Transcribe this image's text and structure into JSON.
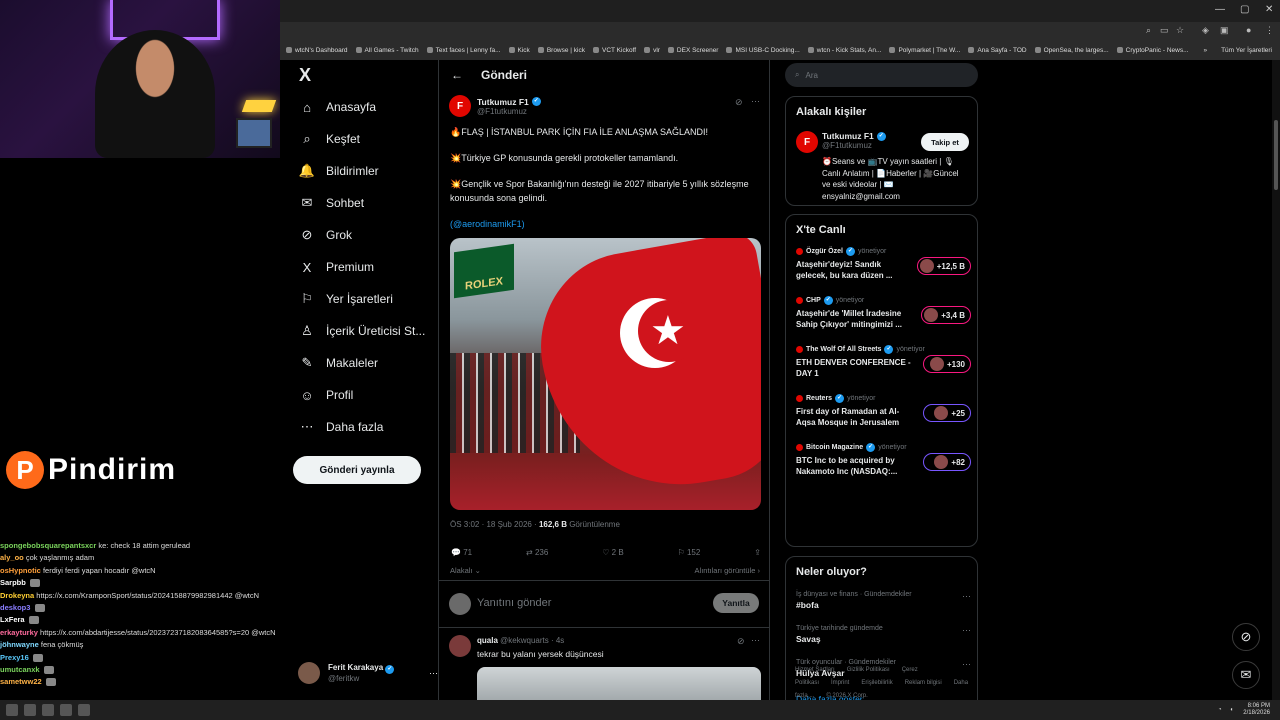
{
  "stream": {
    "brand": "Pindirim",
    "brand_letter": "P",
    "chat": [
      {
        "user": "spongebobsquarepantsxcr",
        "color": "#7ad35c",
        "msg": "ke: check 18 attim gerulead"
      },
      {
        "user": "aly_oo",
        "color": "#ffb347",
        "msg": "çok yaşlanmış adam"
      },
      {
        "user": "osHypnotic",
        "color": "#ff9f3a",
        "msg": "ferdiyi ferdi yapan hocadır @wtcN"
      },
      {
        "user": "Sarpbb",
        "color": "#ffffff",
        "msg": ""
      },
      {
        "user": "Drokeyna",
        "color": "#ffcf33",
        "msg": "https://x.com/KramponSport/status/2024158879982981442 @wtcN"
      },
      {
        "user": "deskop3",
        "color": "#8a7dff",
        "msg": ""
      },
      {
        "user": "LxFera",
        "color": "#ffffff",
        "msg": ""
      },
      {
        "user": "erkayturky",
        "color": "#ff6b9d",
        "msg": "https://x.com/abdartijesse/status/2023723718208364585?s=20 @wtcN"
      },
      {
        "user": "jöhnwayne",
        "color": "#7fd8ff",
        "msg": "fena çökmüş"
      },
      {
        "user": "Prexy16",
        "color": "#5ac8fa",
        "msg": ""
      },
      {
        "user": "umutcanxk",
        "color": "#7ad35c",
        "msg": ""
      },
      {
        "user": "sametww22",
        "color": "#ffb347",
        "msg": ""
      }
    ]
  },
  "browser": {
    "bookmarks": [
      "wtcN's Dashboard",
      "All Games - Twitch",
      "Text faces | Lenny fa...",
      "Kick",
      "Browse | kick",
      "VCT Kickoff",
      "vlr",
      "DEX Screener",
      "MSI USB-C Docking...",
      "wtcn - Kick Stats, An...",
      "Polymarket | The W...",
      "Ana Sayfa - TOD",
      "OpenSea, the larges...",
      "CryptoPanic - News..."
    ],
    "bookmarks_more": "»",
    "all_bookmarks": "Tüm Yer İşaretleri"
  },
  "nav": {
    "logo": "X",
    "items": [
      {
        "label": "Anasayfa",
        "icon": "⌂"
      },
      {
        "label": "Keşfet",
        "icon": "⌕"
      },
      {
        "label": "Bildirimler",
        "icon": "🔔"
      },
      {
        "label": "Sohbet",
        "icon": "✉"
      },
      {
        "label": "Grok",
        "icon": "⊘"
      },
      {
        "label": "Premium",
        "icon": "X"
      },
      {
        "label": "Yer İşaretleri",
        "icon": "⚐"
      },
      {
        "label": "İçerik Üreticisi St...",
        "icon": "♙"
      },
      {
        "label": "Makaleler",
        "icon": "✎"
      },
      {
        "label": "Profil",
        "icon": "☺"
      },
      {
        "label": "Daha fazla",
        "icon": "⋯"
      }
    ],
    "post_button": "Gönderi yayınla",
    "account_name": "Ferit Karakaya",
    "account_handle": "@feritkw"
  },
  "post": {
    "header_title": "Gönderi",
    "author": "Tutkumuz F1",
    "handle": "@F1tutkumuz",
    "line1": "🔥FLAŞ | İSTANBUL PARK İÇİN FIA İLE ANLAŞMA SAĞLANDI!",
    "line2": "💥Türkiye GP konusunda gerekli protokeller tamamlandı.",
    "line3": "💥Gençlik ve Spor Bakanlığı'nın desteği ile 2027 itibariyle 5 yıllık sözleşme konusunda sona gelindi.",
    "mention": "(@aerodinamikF1)",
    "image_sign": "ROLEX",
    "time": "ÖS 3:02 · 18 Şub 2026 · ",
    "views": "162,6 B",
    "views_label": " Görüntülenme",
    "replies": "71",
    "reposts": "236",
    "likes": "2 B",
    "bookmarks": "152",
    "related_left": "Alakalı",
    "related_right": "Alıntıları görüntüle",
    "reply_placeholder": "Yanıtını gönder",
    "reply_button": "Yanıtla"
  },
  "reply": {
    "author": "quala",
    "handle": "@kekwquarts · 4s",
    "text": "tekrar bu yalanı yersek düşüncesi"
  },
  "right": {
    "search_placeholder": "Ara",
    "related_title": "Alakalı kişiler",
    "person_name": "Tutkumuz F1",
    "person_handle": "@F1tutkumuz",
    "follow": "Takip et",
    "bio": "⏰Seans ve 📺TV yayın saatleri | 🎙 Canlı Anlatım | 📄Haberler | 🎥Güncel ve eski videolar | ✉️ ensyalniz@gmail.com",
    "live_title": "X'te Canlı",
    "live": [
      {
        "who": "Özgür Özel",
        "role": "yönetiyor",
        "title": "Ataşehir'deyiz! Sandık gelecek, bu kara düzen ...",
        "count": "+12,5 B"
      },
      {
        "who": "CHP",
        "role": "yönetiyor",
        "title": "Ataşehir'de 'Millet İradesine Sahip Çıkıyor' mitingimizi ...",
        "count": "+3,4 B"
      },
      {
        "who": "The Wolf Of All Streets",
        "role": "yönetiyor",
        "title": "ETH DENVER CONFERENCE - DAY 1",
        "count": "+130"
      },
      {
        "who": "Reuters",
        "role": "yönetiyor",
        "title": "First day of Ramadan at Al-Aqsa Mosque in Jerusalem",
        "count": "+25"
      },
      {
        "who": "Bitcoin Magazine",
        "role": "yönetiyor",
        "title": "BTC Inc to be acquired by Nakamoto Inc (NASDAQ:...",
        "count": "+82"
      }
    ],
    "trends_title": "Neler oluyor?",
    "trends": [
      {
        "cat": "İş dünyası ve finans · Gündemdekiler",
        "topic": "#bofa"
      },
      {
        "cat": "Türkiye tarihinde gündemde",
        "topic": "Savaş"
      },
      {
        "cat": "Türk oyuncular · Gündemdekiler",
        "topic": "Hülya Avşar"
      }
    ],
    "show_more": "Daha fazla göster",
    "footer": [
      "Hizmet Şartları",
      "Gizlilik Politikası",
      "Çerez Politikası",
      "İmprint",
      "Erişilebilirlik",
      "Reklam bilgisi",
      "Daha fazla ...",
      "© 2026 X Corp."
    ]
  },
  "taskbar": {
    "time": "8:06 PM",
    "date": "2/18/2026"
  }
}
